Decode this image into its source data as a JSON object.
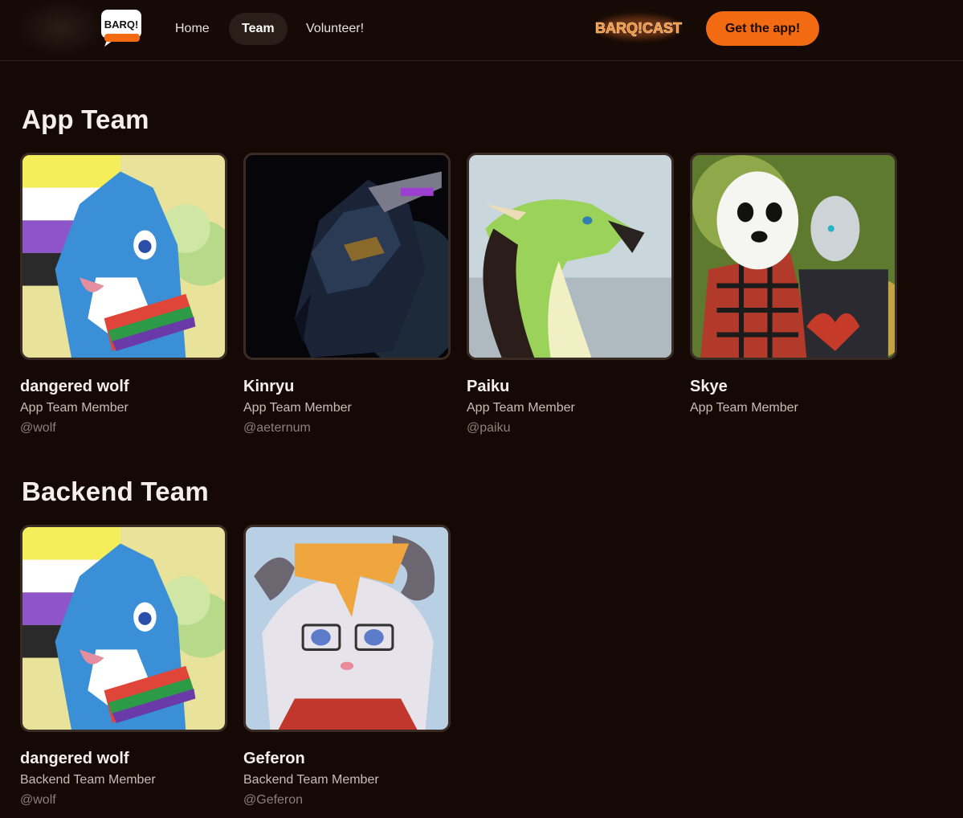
{
  "header": {
    "logo_text": "BARQ!",
    "nav": [
      {
        "label": "Home"
      },
      {
        "label": "Team"
      },
      {
        "label": "Volunteer!"
      }
    ],
    "barqcast_text": "BARQ!CAST",
    "cta_label": "Get the app!",
    "accent_color": "#f26b12"
  },
  "sections": [
    {
      "title": "App Team",
      "members": [
        {
          "name": "dangered wolf",
          "role": "App Team Member",
          "handle": "@wolf"
        },
        {
          "name": "Kinryu",
          "role": "App Team Member",
          "handle": "@aeternum"
        },
        {
          "name": "Paiku",
          "role": "App Team Member",
          "handle": "@paiku"
        },
        {
          "name": "Skye",
          "role": "App Team Member",
          "handle": ""
        }
      ]
    },
    {
      "title": "Backend Team",
      "members": [
        {
          "name": "dangered wolf",
          "role": "Backend Team Member",
          "handle": "@wolf"
        },
        {
          "name": "Geferon",
          "role": "Backend Team Member",
          "handle": "@Geferon"
        }
      ]
    }
  ]
}
